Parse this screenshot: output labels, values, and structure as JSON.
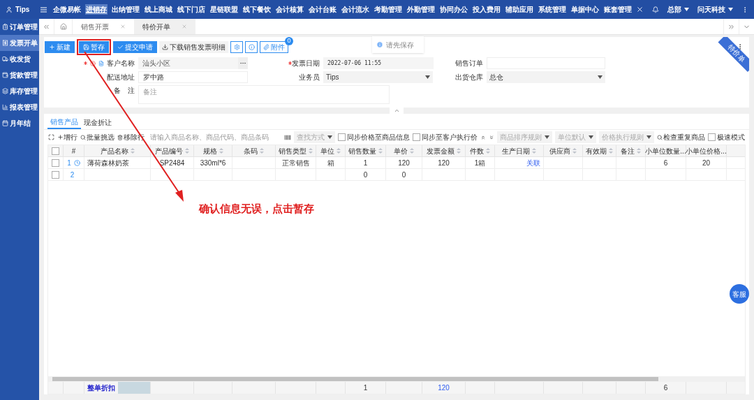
{
  "brand": {
    "name": "Tips"
  },
  "top_menu": [
    {
      "label": "企微易帐",
      "selected": false
    },
    {
      "label": "进销存",
      "selected": true
    },
    {
      "label": "出纳管理",
      "selected": false
    },
    {
      "label": "线上商城",
      "selected": false
    },
    {
      "label": "线下门店",
      "selected": false
    },
    {
      "label": "星链联盟",
      "selected": false
    },
    {
      "label": "线下餐饮",
      "selected": false
    },
    {
      "label": "会计核算",
      "selected": false
    },
    {
      "label": "会计台账",
      "selected": false
    },
    {
      "label": "会计流水",
      "selected": false
    },
    {
      "label": "考勤管理",
      "selected": false
    },
    {
      "label": "外勤管理",
      "selected": false
    },
    {
      "label": "协同办公",
      "selected": false
    },
    {
      "label": "投入费用",
      "selected": false
    },
    {
      "label": "辅助应用",
      "selected": false
    },
    {
      "label": "系统管理",
      "selected": false
    },
    {
      "label": "单据中心",
      "selected": false
    },
    {
      "label": "账套管理",
      "selected": false
    }
  ],
  "top_right": {
    "branch": "总部",
    "company": "问天科技"
  },
  "sidebar": [
    {
      "label": "订单管理",
      "selected": false
    },
    {
      "label": "发票开单",
      "selected": true
    },
    {
      "label": "收发货",
      "selected": false
    },
    {
      "label": "货款管理",
      "selected": false
    },
    {
      "label": "库存管理",
      "selected": false
    },
    {
      "label": "报表管理",
      "selected": false
    },
    {
      "label": "月年结",
      "selected": false
    }
  ],
  "tabs": [
    {
      "label": "销售开票",
      "selected": false
    },
    {
      "label": "特价开单",
      "selected": true
    }
  ],
  "toolbar": {
    "buttons": [
      {
        "label": "新建",
        "kind": "primary",
        "highlighted": false
      },
      {
        "label": "暂存",
        "kind": "primary",
        "highlighted": true
      },
      {
        "label": "提交申请",
        "kind": "primary",
        "highlighted": false
      },
      {
        "label": "下载销售发票明细",
        "kind": "plain",
        "highlighted": false
      }
    ],
    "attachment": {
      "label": "附件",
      "badge": "0"
    }
  },
  "toast": {
    "text": "请先保存"
  },
  "ribbon": {
    "text": "特价单"
  },
  "form": {
    "customer": {
      "label": "客户名称",
      "value": "汕头小区",
      "required": true
    },
    "address": {
      "label": "配送地址",
      "value": "罗中路"
    },
    "remark": {
      "label": "备　注",
      "placeholder": "备注"
    },
    "invoice_date": {
      "label": "发票日期",
      "value": "2022-07-06 11:55",
      "required": true
    },
    "salesperson": {
      "label": "业务员",
      "value": "Tips"
    },
    "sales_order": {
      "label": "销售订单"
    },
    "warehouse": {
      "label": "出货仓库",
      "value": "总仓"
    }
  },
  "collapse_toggle": {
    "expanded": true
  },
  "section_tabs": [
    {
      "label": "销售产品",
      "selected": true
    },
    {
      "label": "现金折让",
      "selected": false
    }
  ],
  "table_toolbar": {
    "add_row": "增行",
    "batch_pick": "批量挑选",
    "remove_row": "移除行",
    "search": {
      "placeholder": "请输入商品名称、商品代码、商品条码"
    },
    "search_mode": {
      "placeholder": "查找方式"
    },
    "sync_product": {
      "label": "同步价格至商品信息",
      "checked": false
    },
    "sync_customer": {
      "label": "同步至客户执行价",
      "checked": false
    },
    "sort_rule": {
      "placeholder": "商品排序规则"
    },
    "unit_default": {
      "placeholder": "单位默认"
    },
    "price_rule": {
      "placeholder": "价格执行规则"
    },
    "check_duplicates": "检查重复商品",
    "fast_mode": {
      "label": "极速模式",
      "checked": false
    }
  },
  "table": {
    "all_checked": false,
    "columns": [
      {
        "label": "#",
        "sortable": false
      },
      {
        "label": "产品名称",
        "sortable": true
      },
      {
        "label": "产品编号",
        "sortable": true
      },
      {
        "label": "规格",
        "sortable": true
      },
      {
        "label": "条码",
        "sortable": true
      },
      {
        "label": "销售类型",
        "sortable": true
      },
      {
        "label": "单位",
        "sortable": true
      },
      {
        "label": "销售数量",
        "sortable": true
      },
      {
        "label": "单价",
        "sortable": true
      },
      {
        "label": "发票金额",
        "sortable": true
      },
      {
        "label": "件数",
        "sortable": true
      },
      {
        "label": "生产日期",
        "sortable": true
      },
      {
        "label": "供应商",
        "sortable": true
      },
      {
        "label": "有效期",
        "sortable": true
      },
      {
        "label": "备注",
        "sortable": true
      },
      {
        "label": "小单位数量...",
        "sortable": false
      },
      {
        "label": "小单位价格...",
        "sortable": false
      }
    ],
    "rows": [
      {
        "checked": false,
        "clock_icon": true,
        "cells": [
          "1",
          "薄荷森林奶茶",
          "SP2484",
          "330ml*6",
          null,
          "正常销售",
          "箱",
          "1",
          "120",
          "120",
          "1箱",
          {
            "text": "关联",
            "kind": "link"
          },
          null,
          null,
          null,
          "6",
          "20"
        ]
      },
      {
        "checked": false,
        "clock_icon": false,
        "cells": [
          "2",
          null,
          null,
          null,
          null,
          null,
          null,
          "0",
          "0",
          null,
          null,
          null,
          null,
          null,
          null,
          null,
          null
        ]
      }
    ],
    "footer": {
      "label": "整单折扣",
      "cells": [
        null,
        null,
        null,
        null,
        null,
        null,
        null,
        "1",
        null,
        {
          "text": "120",
          "kind": "link"
        },
        null,
        null,
        null,
        null,
        null,
        "6",
        null
      ]
    }
  },
  "annotation": {
    "text": "确认信息无误，点击暂存"
  },
  "chat": {
    "label": "客服"
  }
}
